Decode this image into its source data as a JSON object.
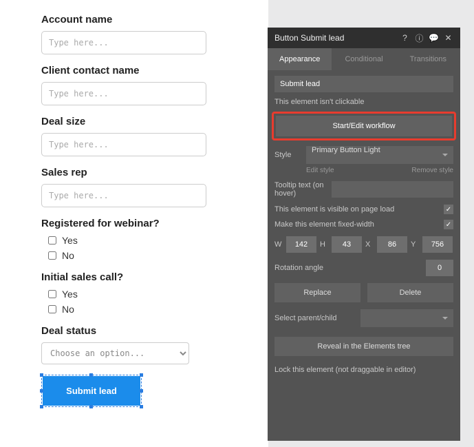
{
  "form": {
    "fields": [
      {
        "label": "Account name",
        "placeholder": "Type here..."
      },
      {
        "label": "Client contact name",
        "placeholder": "Type here..."
      },
      {
        "label": "Deal size",
        "placeholder": "Type here..."
      },
      {
        "label": "Sales rep",
        "placeholder": "Type here..."
      }
    ],
    "registered": {
      "label": "Registered for webinar?",
      "yes": "Yes",
      "no": "No"
    },
    "initial_call": {
      "label": "Initial sales call?",
      "yes": "Yes",
      "no": "No"
    },
    "deal_status": {
      "label": "Deal status",
      "placeholder": "Choose an option..."
    },
    "submit_label": "Submit lead"
  },
  "inspector": {
    "title": "Button Submit lead",
    "tabs": {
      "appearance": "Appearance",
      "conditional": "Conditional",
      "transitions": "Transitions"
    },
    "element_text": "Submit lead",
    "not_clickable": "This element isn't clickable",
    "workflow_btn": "Start/Edit workflow",
    "style_label": "Style",
    "style_value": "Primary Button Light",
    "edit_style": "Edit style",
    "remove_style": "Remove style",
    "tooltip_label": "Tooltip text (on hover)",
    "visible_label": "This element is visible on page load",
    "fixed_width_label": "Make this element fixed-width",
    "dims": {
      "w_label": "W",
      "w": "142",
      "h_label": "H",
      "h": "43",
      "x_label": "X",
      "x": "86",
      "y_label": "Y",
      "y": "756"
    },
    "rotation_label": "Rotation angle",
    "rotation_value": "0",
    "replace": "Replace",
    "delete": "Delete",
    "select_parent": "Select parent/child",
    "reveal": "Reveal in the Elements tree",
    "lock": "Lock this element (not draggable in editor)"
  }
}
